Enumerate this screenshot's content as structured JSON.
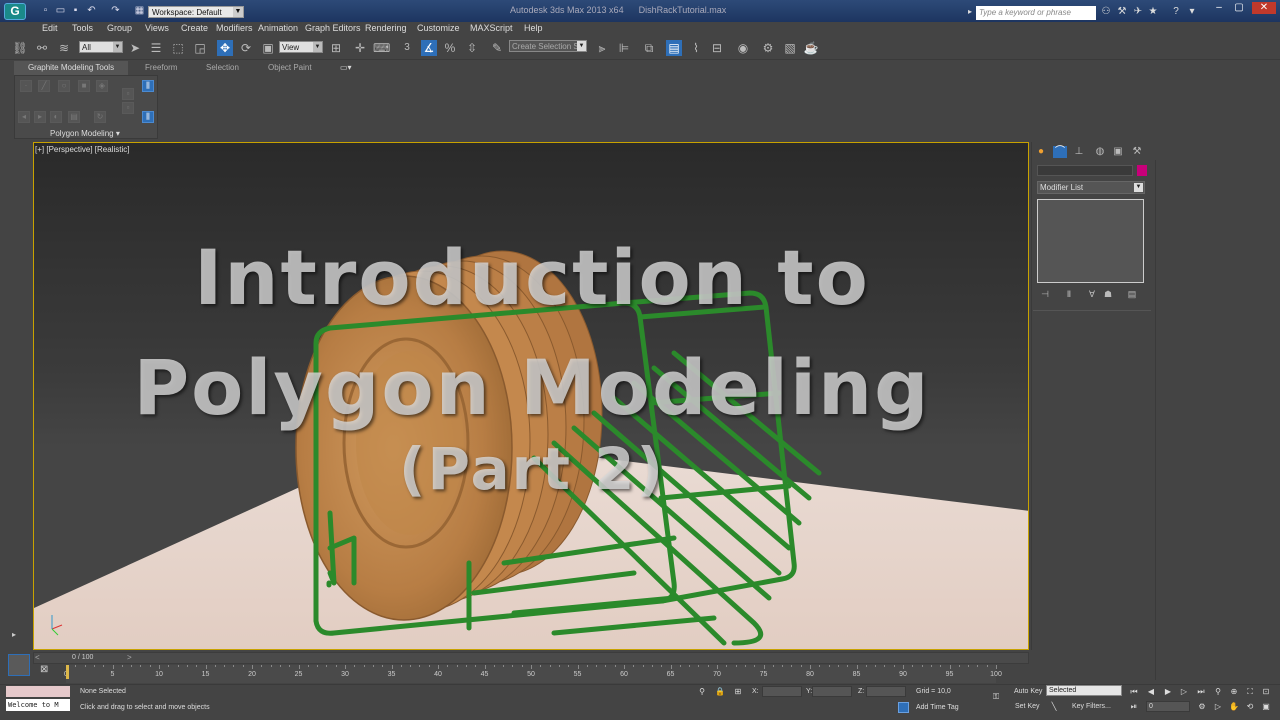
{
  "app": {
    "title": "Autodesk 3ds Max 2013 x64",
    "file": "DishRackTutorial.max",
    "logo_letter": "G",
    "workspace_label": "Workspace: Default",
    "search_placeholder": "Type a keyword or phrase"
  },
  "menu": [
    "Edit",
    "Tools",
    "Group",
    "Views",
    "Create",
    "Modifiers",
    "Animation",
    "Graph Editors",
    "Rendering",
    "Customize",
    "MAXScript",
    "Help"
  ],
  "toolbar": {
    "filter_value": "All",
    "refcoord_value": "View",
    "named_selection_placeholder": "Create Selection Se",
    "snap_label": "3"
  },
  "ribbon": {
    "tabs": [
      "Graphite Modeling Tools",
      "Freeform",
      "Selection",
      "Object Paint"
    ],
    "panel_label": "Polygon Modeling ▾"
  },
  "viewport": {
    "label": "[+] [Perspective] [Realistic]",
    "overlay_lines": [
      "Introduction to",
      "Polygon Modeling",
      "(Part 2)"
    ]
  },
  "command_panel": {
    "modifier_list": "Modifier List"
  },
  "timeline": {
    "frame_display": "0 / 100",
    "ticks": [
      0,
      5,
      10,
      15,
      20,
      25,
      30,
      35,
      40,
      45,
      50,
      55,
      60,
      65,
      70,
      75,
      80,
      85,
      90,
      95,
      100
    ]
  },
  "status": {
    "selection": "None Selected",
    "prompt": "Click and drag to select and move objects",
    "maxscript_text": "Welcome to M",
    "x_label": "X:",
    "y_label": "Y:",
    "z_label": "Z:",
    "grid": "Grid = 10,0",
    "add_time_tag": "Add Time Tag",
    "auto_key": "Auto Key",
    "set_key": "Set Key",
    "selected_value": "Selected",
    "key_filters": "Key Filters...",
    "frame_value": "0"
  },
  "colors": {
    "viewport_border": "#c8a200",
    "accent_blue": "#2e6fb8",
    "object_color": "#c8007a",
    "rack_green": "#2b8a2b",
    "plate_orange": "#c88a4e",
    "floor": "#e9d6cd"
  }
}
